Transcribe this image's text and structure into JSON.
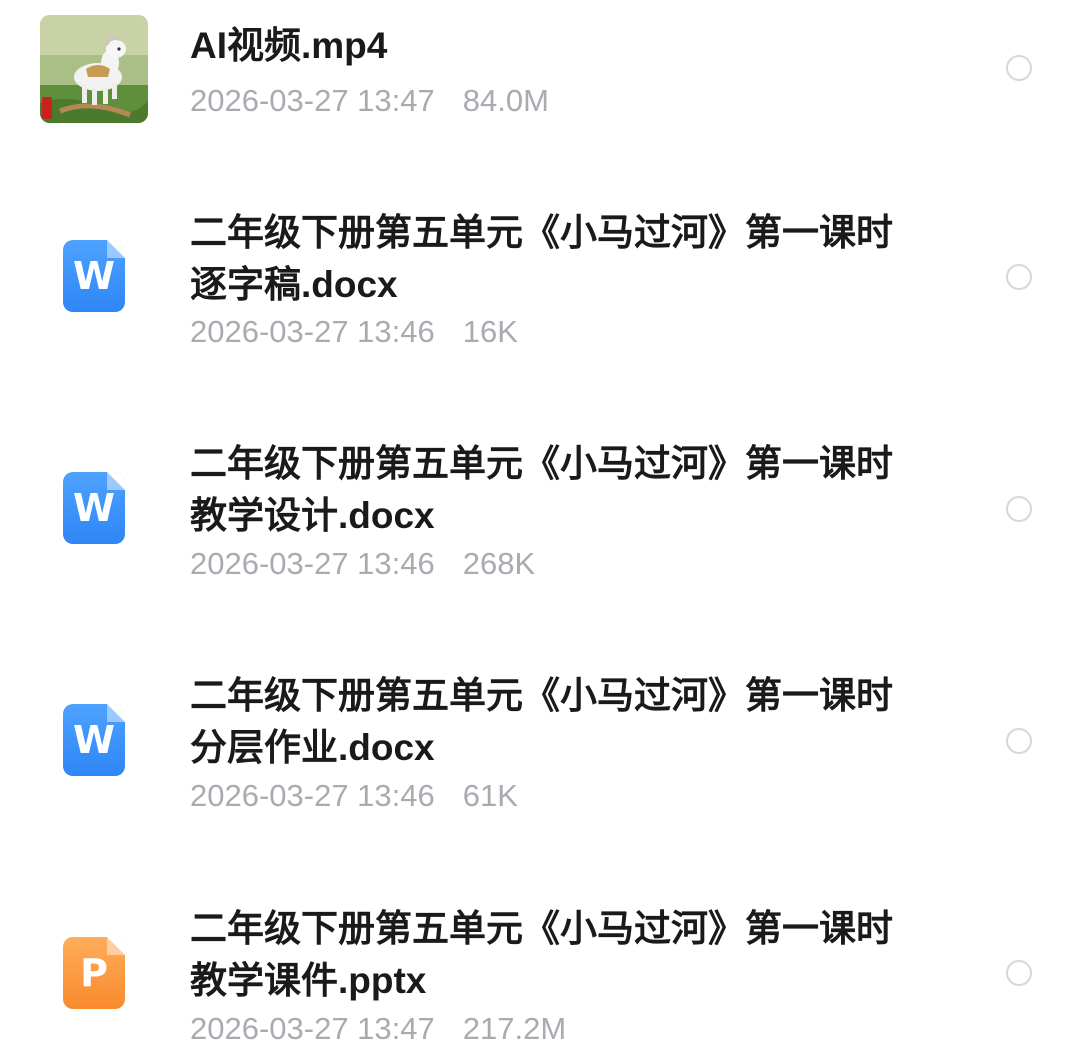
{
  "files": [
    {
      "type": "video",
      "name_line1": "AI视频.mp4",
      "name_line2": "",
      "date": "2026-03-27 13:47",
      "size": "84.0M"
    },
    {
      "type": "word",
      "icon_glyph": "W",
      "name_line1": "二年级下册第五单元《小马过河》第一课时",
      "name_line2": "逐字稿.docx",
      "date": "2026-03-27 13:46",
      "size": "16K"
    },
    {
      "type": "word",
      "icon_glyph": "W",
      "name_line1": "二年级下册第五单元《小马过河》第一课时",
      "name_line2": "教学设计.docx",
      "date": "2026-03-27 13:46",
      "size": "268K"
    },
    {
      "type": "word",
      "icon_glyph": "W",
      "name_line1": "二年级下册第五单元《小马过河》第一课时",
      "name_line2": "分层作业.docx",
      "date": "2026-03-27 13:46",
      "size": "61K"
    },
    {
      "type": "ppt",
      "icon_glyph": "P",
      "name_line1": "二年级下册第五单元《小马过河》第一课时",
      "name_line2": "教学课件.pptx",
      "date": "2026-03-27 13:47",
      "size": "217.2M"
    }
  ],
  "colors": {
    "word_icon": "#2f86f6",
    "ppt_icon": "#f98a2d",
    "title_text": "#1a1a1a",
    "meta_text": "#a9abb0",
    "radio_border": "#d6d7da"
  }
}
